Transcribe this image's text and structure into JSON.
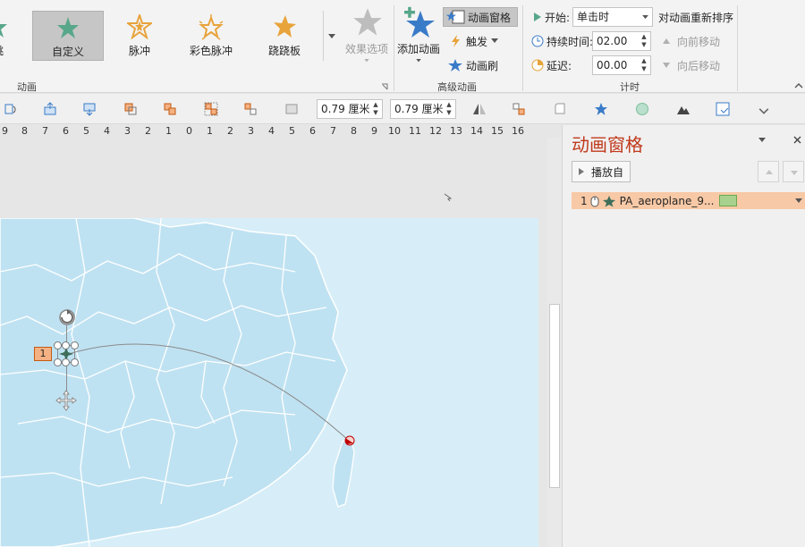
{
  "ribbon": {
    "gallery": {
      "items": [
        {
          "label": "跳",
          "icon": "bounce-star-icon"
        },
        {
          "label": "自定义",
          "icon": "custom-path-star-icon",
          "selected": true
        },
        {
          "label": "脉冲",
          "icon": "pulse-star-icon"
        },
        {
          "label": "彩色脉冲",
          "icon": "color-pulse-star-icon"
        },
        {
          "label": "跷跷板",
          "icon": "teeter-star-icon"
        }
      ],
      "more_icon": "gallery-more-icon",
      "effect_options_label": "效果选项",
      "group_label": "动画"
    },
    "advanced": {
      "add_animation_label": "添加动画",
      "animation_pane_label": "动画窗格",
      "trigger_label": "触发",
      "painter_label": "动画刷",
      "group_label": "高级动画"
    },
    "timing": {
      "start_label": "开始:",
      "start_value": "单击时",
      "duration_label": "持续时间:",
      "duration_value": "02.00",
      "delay_label": "延迟:",
      "delay_value": "00.00",
      "reorder_label": "对动画重新排序",
      "move_earlier_label": "向前移动",
      "move_later_label": "向后移动",
      "group_label": "计时"
    }
  },
  "toolbar2": {
    "height_value": "0.79 厘米",
    "width_value": "0.79 厘米"
  },
  "ruler": {
    "ticks": [
      "9",
      "8",
      "7",
      "6",
      "5",
      "4",
      "3",
      "2",
      "1",
      "0",
      "1",
      "2",
      "3",
      "4",
      "5",
      "6",
      "7",
      "8",
      "9",
      "10",
      "11",
      "12",
      "13",
      "14",
      "15",
      "16"
    ]
  },
  "slide": {
    "animation_badge": "1"
  },
  "pane": {
    "title": "动画窗格",
    "play_label": "播放自",
    "items": [
      {
        "index": "1",
        "name": "PA_aeroplane_9...",
        "color": "#a9d18e"
      }
    ]
  },
  "colors": {
    "accent": "#c0391b",
    "selected_row": "#f8c9a6",
    "map_land": "#bfe2f2",
    "map_sea": "#d7eef8"
  }
}
